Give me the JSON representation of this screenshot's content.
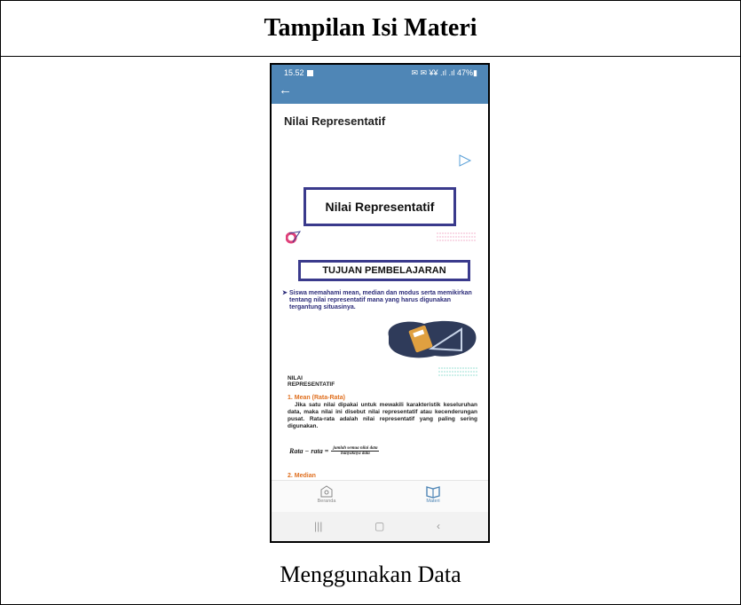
{
  "doc": {
    "header": "Tampilan Isi Materi",
    "caption": "Menggunakan Data"
  },
  "phone": {
    "status": {
      "time": "15.52",
      "indicators": "✉ ✉ ¥¥ .ıl .ıl 47%▮"
    },
    "page_title": "Nilai Representatif",
    "content": {
      "title_box": "Nilai Representatif",
      "tujuan": "TUJUAN PEMBELAJARAN",
      "goal": "Siswa memahami mean, median dan modus serta memikirkan tentang nilai representatif mana yang harus digunakan tergantung situasinya.",
      "section_line1": "NILAI",
      "section_line2": "REPRESENTATIF",
      "mean_title": "1. Mean (Rata-Rata)",
      "mean_body": "Jika satu nilai dipakai untuk mewakili karakteristik keseluruhan data, maka nilai ini disebut nilai representatif atau kecenderungan pusat. Rata-rata adalah nilai representatif yang paling sering digunakan.",
      "formula_lhs": "Rata − rata =",
      "formula_num": "jumlah semua nilai data",
      "formula_den": "banyaknya data",
      "median_title": "2. Median"
    },
    "nav": {
      "home": "Beranda",
      "materi": "Materi"
    }
  },
  "colors": {
    "appbar": "#4f86b6",
    "box_border": "#3a3a8c",
    "accent_orange": "#e07020"
  }
}
